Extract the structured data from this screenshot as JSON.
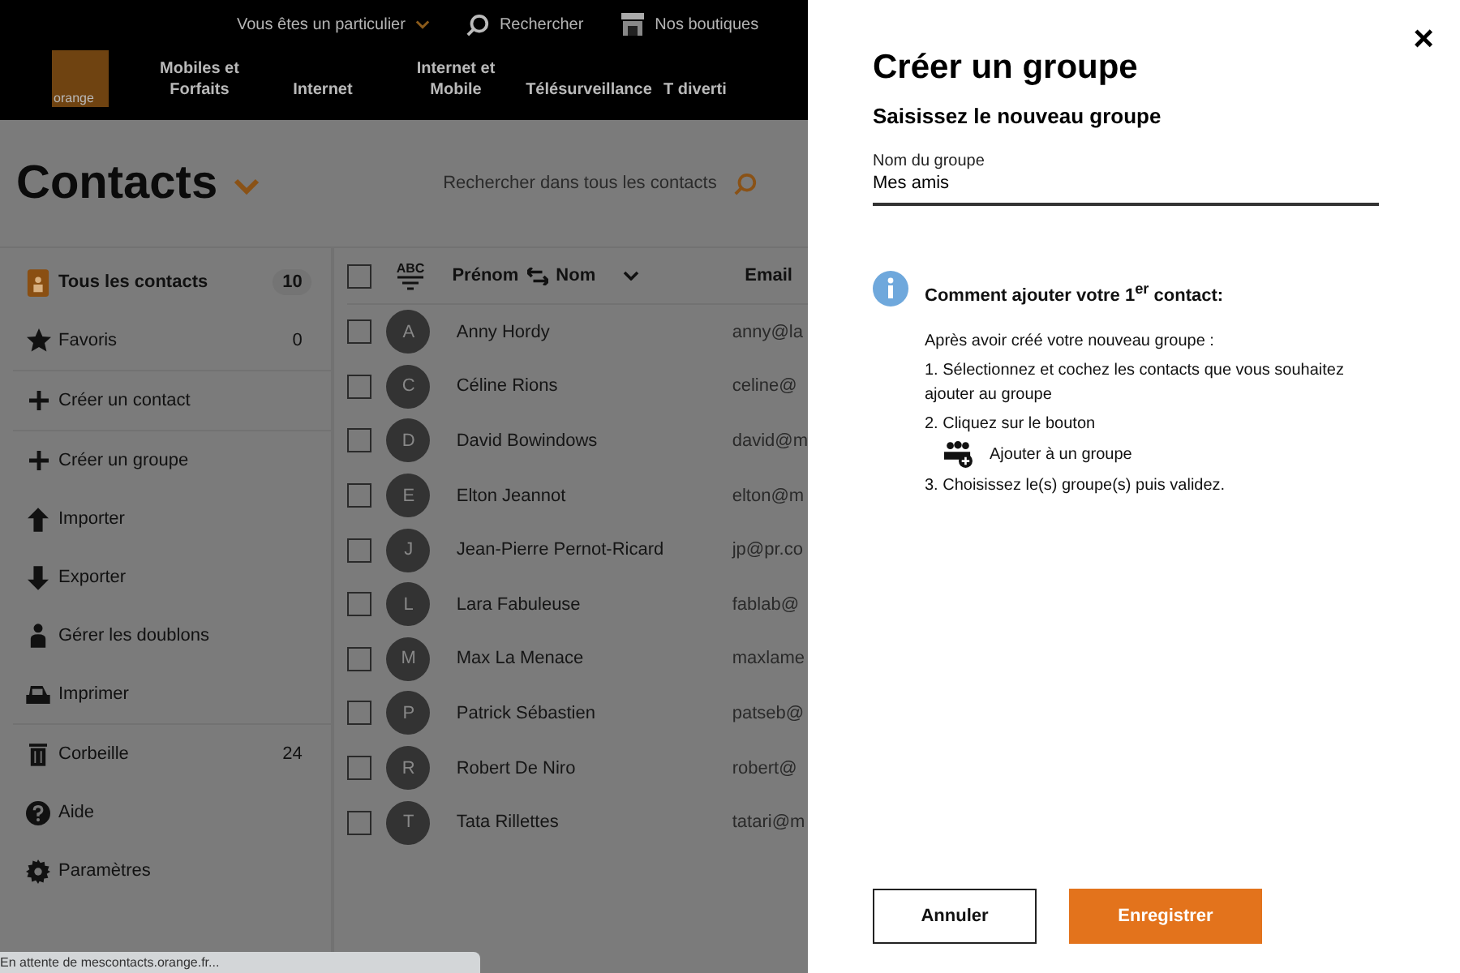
{
  "top_bar": {
    "segment": "Vous êtes un particulier",
    "search": "Rechercher",
    "shops": "Nos boutiques"
  },
  "logo": "orange",
  "nav": [
    "Mobiles et Forfaits",
    "Internet",
    "Internet et Mobile",
    "Télésurveillance",
    "T diverti"
  ],
  "page": {
    "title": "Contacts",
    "search_placeholder": "Rechercher dans tous les contacts"
  },
  "sidebar": {
    "items": [
      {
        "kind": "book",
        "label": "Tous les contacts",
        "count": "10",
        "selected": true
      },
      {
        "kind": "star",
        "label": "Favoris",
        "count": "0",
        "selected": false
      },
      {
        "kind": "plus",
        "label": "Créer un contact",
        "selected": false
      },
      {
        "kind": "plus",
        "label": "Créer un groupe",
        "selected": false
      },
      {
        "kind": "up",
        "label": "Importer",
        "selected": false
      },
      {
        "kind": "down",
        "label": "Exporter",
        "selected": false
      },
      {
        "kind": "person",
        "label": "Gérer les doublons",
        "selected": false
      },
      {
        "kind": "print",
        "label": "Imprimer",
        "selected": false
      },
      {
        "kind": "trash",
        "label": "Corbeille",
        "count": "24",
        "selected": false
      },
      {
        "kind": "help",
        "label": "Aide",
        "selected": false
      },
      {
        "kind": "gear",
        "label": "Paramètres",
        "selected": false
      }
    ]
  },
  "table": {
    "sort_label": "ABC",
    "columns": [
      "Prénom",
      "Nom",
      "Email"
    ],
    "all_checked": false,
    "rows": [
      {
        "initial": "A",
        "name": "Anny Hordy",
        "email": "anny@la",
        "checked": false
      },
      {
        "initial": "C",
        "name": "Céline Rions",
        "email": "celine@",
        "checked": false
      },
      {
        "initial": "D",
        "name": "David Bowindows",
        "email": "david@m",
        "checked": false
      },
      {
        "initial": "E",
        "name": "Elton Jeannot",
        "email": "elton@m",
        "checked": false
      },
      {
        "initial": "J",
        "name": "Jean-Pierre Pernot-Ricard",
        "email": "jp@pr.co",
        "checked": false
      },
      {
        "initial": "L",
        "name": "Lara Fabuleuse",
        "email": "fablab@",
        "checked": false
      },
      {
        "initial": "M",
        "name": "Max La Menace",
        "email": "maxlame",
        "checked": false
      },
      {
        "initial": "P",
        "name": "Patrick Sébastien",
        "email": "patseb@",
        "checked": false
      },
      {
        "initial": "R",
        "name": "Robert De Niro",
        "email": "robert@",
        "checked": false
      },
      {
        "initial": "T",
        "name": "Tata Rillettes",
        "email": "tatari@m",
        "checked": false
      }
    ]
  },
  "status_bar": "En attente de mescontacts.orange.fr...",
  "panel": {
    "close": "×",
    "title": "Créer un groupe",
    "subtitle": "Saisissez le nouveau groupe",
    "field": {
      "label": "Nom du groupe",
      "value": "Mes amis"
    },
    "info": {
      "heading": "Comment ajouter votre 1$^{er}$ contact:",
      "intro": "Après avoir créé votre nouveau groupe :",
      "step1": "1. Sélectionnez et cochez les contacts que vous souhaitez ajouter au groupe",
      "step2": "2. Cliquez sur le bouton",
      "button_label": "Ajouter à un groupe",
      "step3": "3. Choisissez le(s) groupe(s) puis validez."
    },
    "buttons": [
      {
        "kind": "secondary",
        "label": "Annuler"
      },
      {
        "kind": "primary",
        "label": "Enregistrer"
      }
    ]
  }
}
